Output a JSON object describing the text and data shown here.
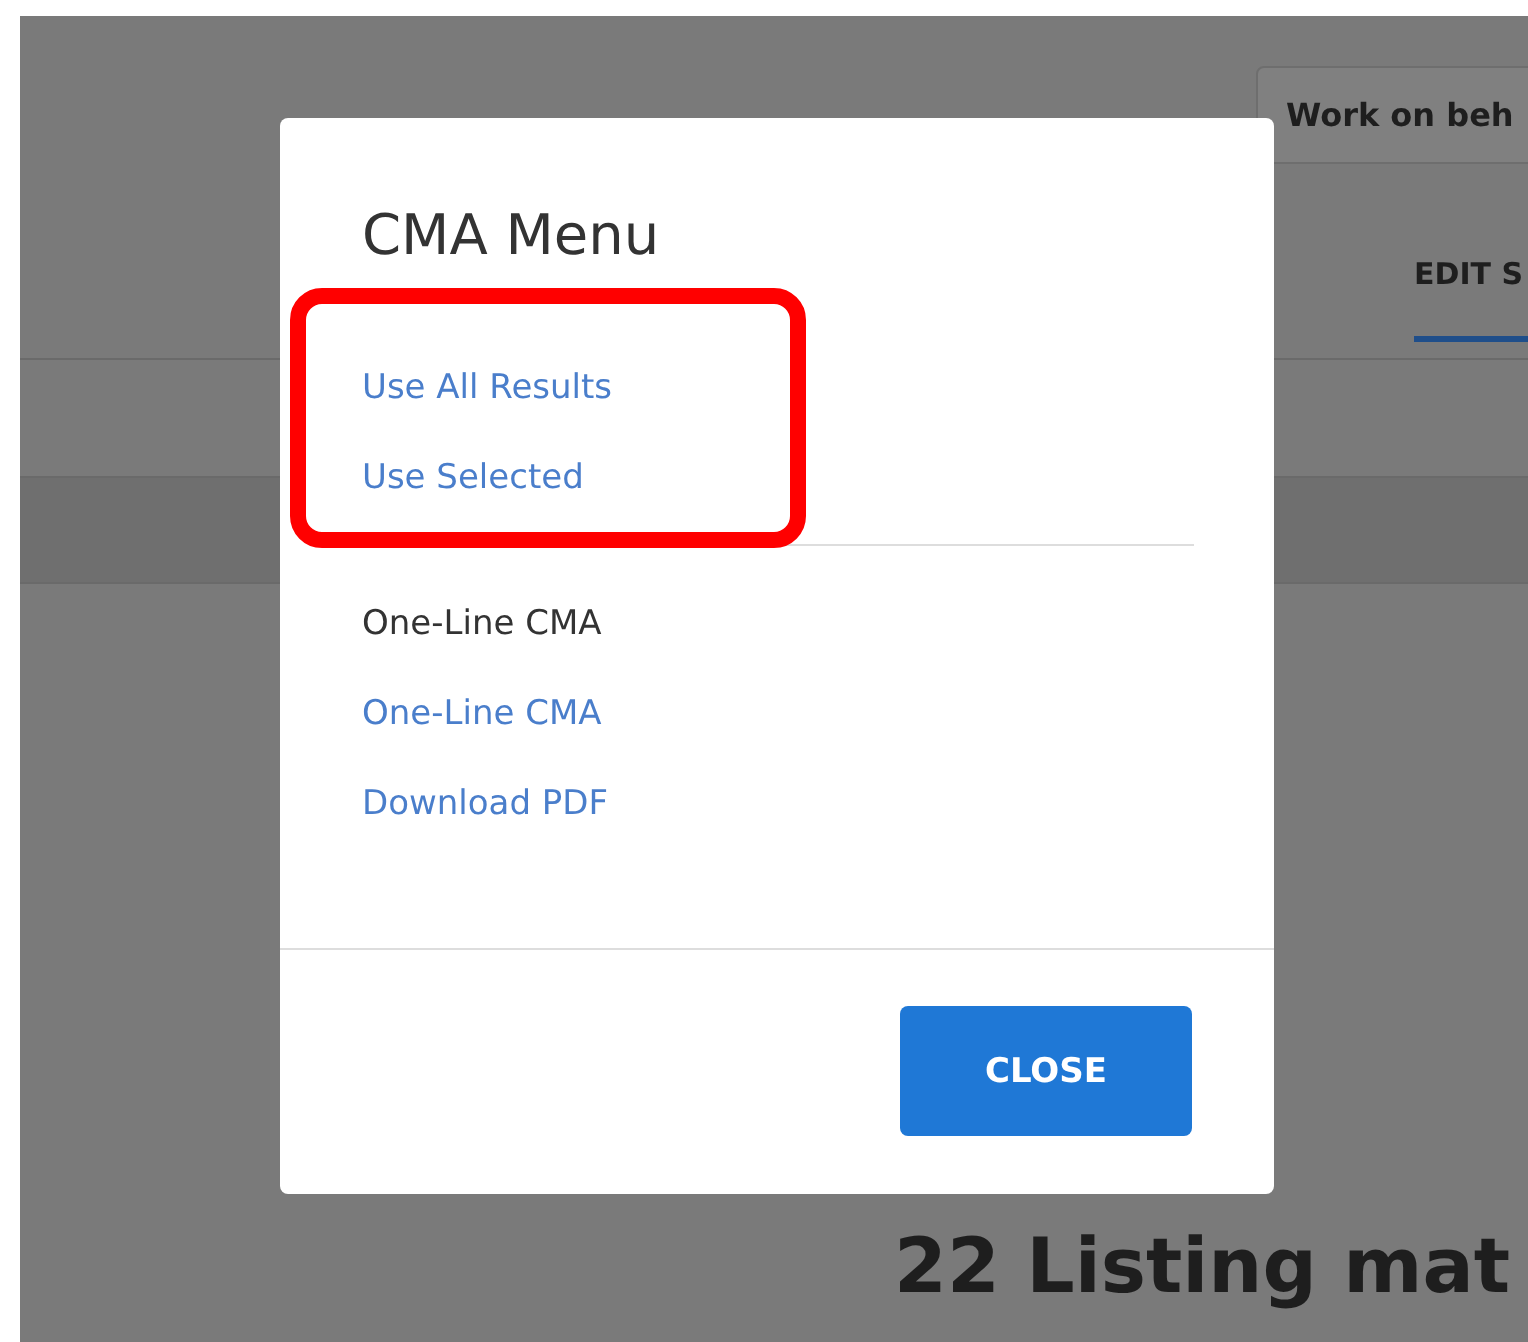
{
  "background": {
    "account_button": "Work on beh",
    "tabs": [
      {
        "label": "EDIT S",
        "selected": true
      }
    ],
    "results_heading": "22 Listing mat"
  },
  "modal": {
    "title": "CMA Menu",
    "groups": [
      {
        "highlighted": true,
        "items": [
          {
            "kind": "link",
            "label": "Use All Results"
          },
          {
            "kind": "link",
            "label": "Use Selected"
          }
        ]
      },
      {
        "highlighted": false,
        "items": [
          {
            "kind": "heading",
            "label": "One-Line CMA"
          },
          {
            "kind": "link",
            "label": "One-Line CMA"
          },
          {
            "kind": "link",
            "label": "Download PDF"
          }
        ]
      }
    ],
    "buttons": [
      "CLOSE"
    ]
  }
}
